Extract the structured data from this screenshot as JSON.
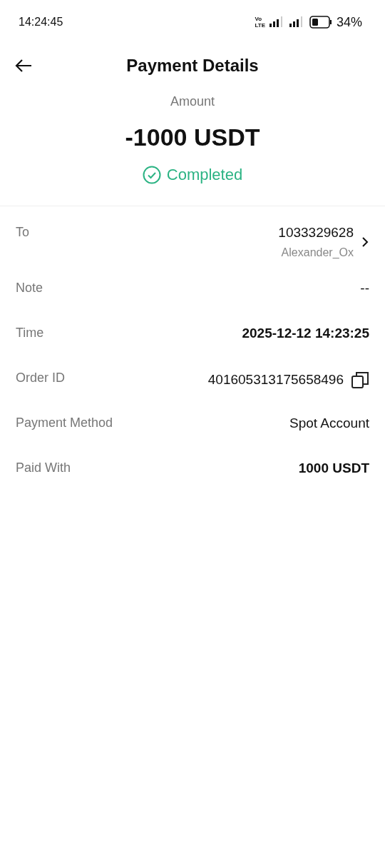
{
  "status_bar": {
    "time": "14:24:45",
    "network_top": "Vo",
    "network_bottom": "LTE",
    "battery": "34%"
  },
  "header": {
    "title": "Payment Details"
  },
  "summary": {
    "label": "Amount",
    "amount": "-1000 USDT",
    "status": "Completed"
  },
  "rows": [
    {
      "kind": "recipient",
      "label": "To",
      "value": "1033329628",
      "sub": "Alexander_Ox",
      "emphasis": false
    },
    {
      "kind": "plain",
      "label": "Note",
      "value": "--",
      "emphasis": false
    },
    {
      "kind": "plain",
      "label": "Time",
      "value": "2025-12-12 14:23:25",
      "emphasis": true
    },
    {
      "kind": "copy",
      "label": "Order ID",
      "value": "401605313175658496",
      "emphasis": false
    },
    {
      "kind": "plain",
      "label": "Payment Method",
      "value": "Spot Account",
      "emphasis": false
    },
    {
      "kind": "plain",
      "label": "Paid With",
      "value": "1000 USDT",
      "emphasis": true
    }
  ]
}
